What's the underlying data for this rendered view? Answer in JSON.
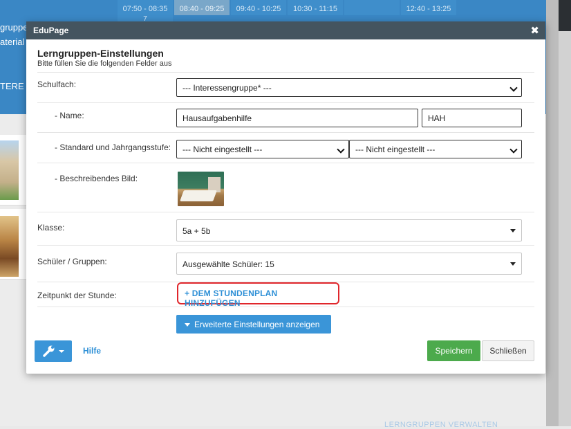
{
  "background": {
    "periods": [
      {
        "time": "07:50 - 08:35",
        "active": false
      },
      {
        "time": "08:40 - 09:25",
        "active": true
      },
      {
        "time": "09:40 - 10:25",
        "active": false
      },
      {
        "time": "10:30 - 11:15",
        "active": false
      },
      {
        "time": "",
        "active": false
      },
      {
        "time": "12:40 - 13:25",
        "active": false
      }
    ],
    "period_extra": "7",
    "side_texts": [
      "gruppe",
      "aterial",
      "TERE I"
    ],
    "bottom_link": "LERNGRUPPEN VERWALTEN"
  },
  "modal": {
    "title": "EduPage",
    "close_glyph": "✖",
    "heading": "Lerngruppen-Einstellungen",
    "subheading": "Bitte füllen Sie die folgenden Felder aus",
    "fields": {
      "subject_label": "Schulfach:",
      "subject_value": "--- Interessengruppe* ---",
      "name_label": "- Name:",
      "name_value": "Hausaufgabenhilfe",
      "short_value": "HAH",
      "level_label": "- Standard und Jahrgangsstufe:",
      "level_value1": "--- Nicht eingestellt ---",
      "level_value2": "--- Nicht eingestellt ---",
      "image_label": "- Beschreibendes Bild:",
      "class_label": "Klasse:",
      "class_value": "5a + 5b",
      "students_label": "Schüler / Gruppen:",
      "students_value": "Ausgewählte Schüler: 15",
      "time_label": "Zeitpunkt der Stunde:",
      "add_timetable": "+ DEM STUNDENPLAN HINZUFÜGEN",
      "advanced": "Erweiterte Einstellungen anzeigen"
    },
    "footer": {
      "help": "Hilfe",
      "save": "Speichern",
      "close": "Schließen"
    }
  },
  "colors": {
    "header_blue": "#3a87c5",
    "titlebar": "#44545f",
    "primary": "#3a95d8",
    "save_green": "#4caa4c",
    "highlight_red": "#e0262b"
  }
}
